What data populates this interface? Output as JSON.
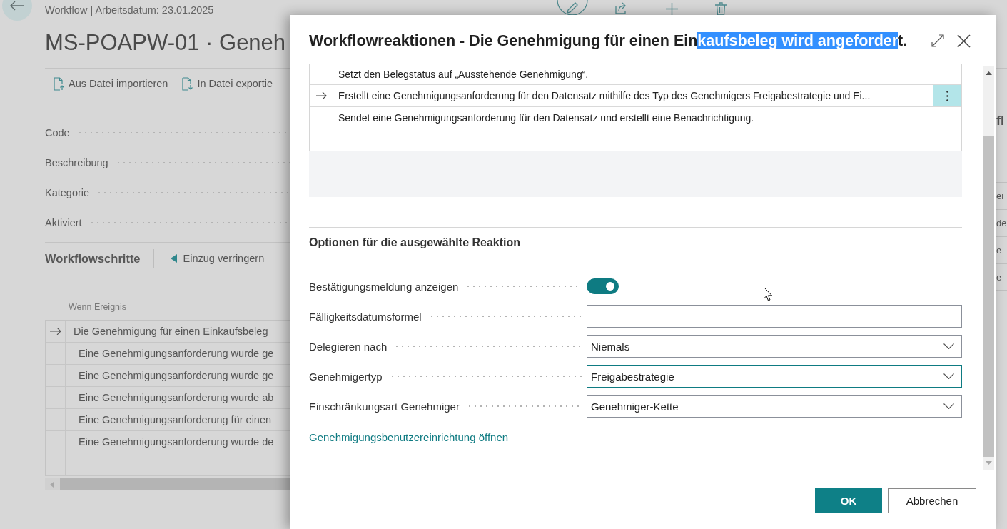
{
  "page": {
    "breadcrumb": "Workflow | Arbeitsdatum: 23.01.2025",
    "title": "MS-POAPW-01 · Geneh",
    "actions": [
      {
        "label": "Aus Datei importieren",
        "kind": "import"
      },
      {
        "label": "In Datei exportie",
        "kind": "export"
      }
    ],
    "fields": [
      {
        "label": "Code"
      },
      {
        "label": "Beschreibung"
      },
      {
        "label": "Kategorie"
      },
      {
        "label": "Aktiviert"
      }
    ],
    "steps": {
      "title": "Workflowschritte",
      "actions": [
        {
          "label": "Einzug verringern"
        }
      ],
      "columns": [
        "Wenn Ereignis"
      ],
      "rows": [
        {
          "text": "Die Genehmigung für einen Einkaufsbeleg",
          "selected": true,
          "children": [
            {
              "text": "Eine Genehmigungsanforderung wurde ge",
              "selected": false
            },
            {
              "text": "Eine Genehmigungsanforderung wurde ge",
              "selected": false
            },
            {
              "text": "Eine Genehmigungsanforderung wurde ab",
              "selected": false
            },
            {
              "text": "Eine Genehmigungsanforderung für einen",
              "selected": false
            },
            {
              "text": "Eine Genehmigungsanforderung wurde de",
              "selected": false
            }
          ]
        }
      ]
    },
    "factbox": {
      "title": "fl",
      "rows": [
        "ei",
        "de",
        "e",
        "e"
      ]
    }
  },
  "dialog": {
    "title": [
      {
        "text": "Workflowreaktionen - Die Genehmigung für einen Ein",
        "selected": false
      },
      {
        "text": "kaufsbeleg wird angeforder",
        "selected": true
      },
      {
        "text": "t.",
        "selected": false
      }
    ],
    "table": {
      "rows": [
        {
          "text": "Setzt den Belegstatus auf „Ausstehende Genehmigung“.",
          "selected": false
        },
        {
          "text": "Erstellt eine Genehmigungsanforderung für den Datensatz mithilfe des Typ des Genehmigers Freigabestrategie und Ei...",
          "selected": true
        },
        {
          "text": "Sendet eine Genehmigungsanforderung für den Datensatz und erstellt eine Benachrichtigung.",
          "selected": false
        }
      ]
    },
    "options": {
      "title": "Optionen für die ausgewählte Reaktion",
      "fields": [
        {
          "kind": "toggle",
          "label": "Bestätigungsmeldung anzeigen",
          "on": true
        },
        {
          "kind": "text",
          "label": "Fälligkeitsdatumsformel",
          "focused": false
        },
        {
          "kind": "select",
          "label": "Delegieren nach",
          "value": "Niemals",
          "focused": false
        },
        {
          "kind": "select",
          "label": "Genehmigertyp",
          "value": "Freigabestrategie",
          "focused": true
        },
        {
          "kind": "select",
          "label": "Einschränkungsart Genehmiger",
          "value": "Genehmiger-Kette",
          "focused": false
        }
      ],
      "link": "Genehmigungsbenutzereinrichtung öffnen"
    },
    "buttons": [
      {
        "label": "OK",
        "kind": "primary"
      },
      {
        "label": "Abbrechen",
        "kind": "secondary"
      }
    ]
  }
}
